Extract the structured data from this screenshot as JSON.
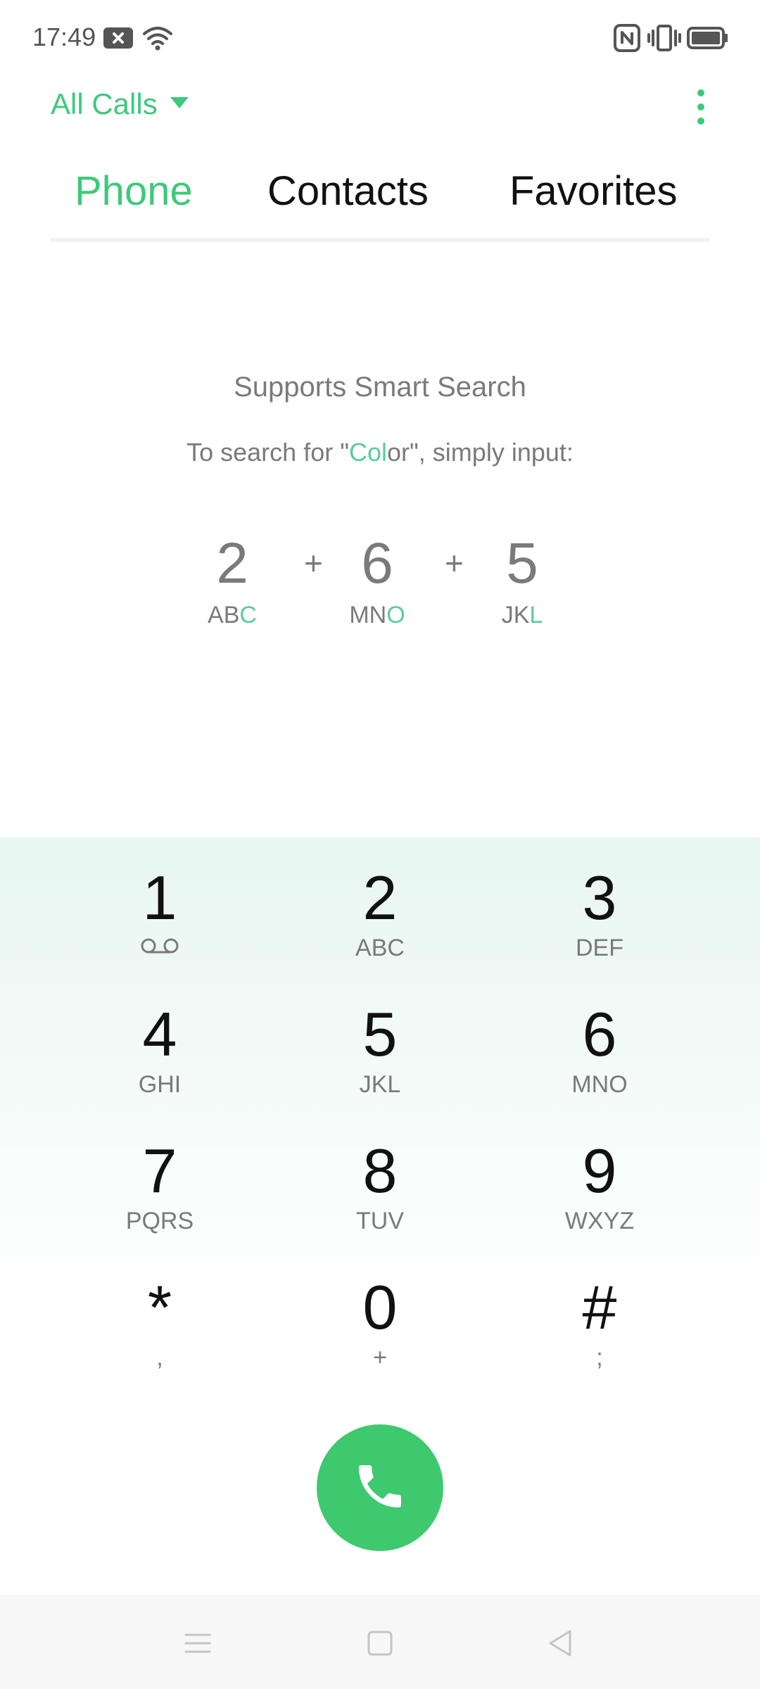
{
  "status": {
    "time": "17:49",
    "icons": [
      "notification-x-icon",
      "wifi-icon",
      "nfc-icon",
      "vibrate-icon",
      "battery-icon"
    ]
  },
  "header": {
    "filter_label": "All Calls",
    "icons": [
      "dropdown-triangle-icon",
      "more-vertical-icon"
    ]
  },
  "tabs": [
    {
      "label": "Phone",
      "active": true
    },
    {
      "label": "Contacts",
      "active": false
    },
    {
      "label": "Favorites",
      "active": false
    }
  ],
  "hint": {
    "title": "Supports Smart Search",
    "sub_prefix": "To search for \"",
    "sub_highlight": "Col",
    "sub_rest": "or\", simply input:",
    "plus": "+",
    "keys": [
      {
        "digit": "2",
        "letters": "AB",
        "highlight": "C"
      },
      {
        "digit": "6",
        "letters": "MN",
        "highlight": "O"
      },
      {
        "digit": "5",
        "letters": "JK",
        "highlight": "L"
      }
    ]
  },
  "dialpad": {
    "keys": [
      {
        "digit": "1",
        "sub": "",
        "sub_icon": "voicemail-icon"
      },
      {
        "digit": "2",
        "sub": "ABC"
      },
      {
        "digit": "3",
        "sub": "DEF"
      },
      {
        "digit": "4",
        "sub": "GHI"
      },
      {
        "digit": "5",
        "sub": "JKL"
      },
      {
        "digit": "6",
        "sub": "MNO"
      },
      {
        "digit": "7",
        "sub": "PQRS"
      },
      {
        "digit": "8",
        "sub": "TUV"
      },
      {
        "digit": "9",
        "sub": "WXYZ"
      },
      {
        "digit": "*",
        "sub": ","
      },
      {
        "digit": "0",
        "sub": "+"
      },
      {
        "digit": "#",
        "sub": ";"
      }
    ],
    "call_icon": "phone-icon"
  },
  "navbar": {
    "icons": [
      "menu-icon",
      "home-square-icon",
      "back-triangle-icon"
    ]
  },
  "colors": {
    "accent": "#3ec97a",
    "call_button": "#3ec96f",
    "muted_text": "#7a7a7a"
  }
}
